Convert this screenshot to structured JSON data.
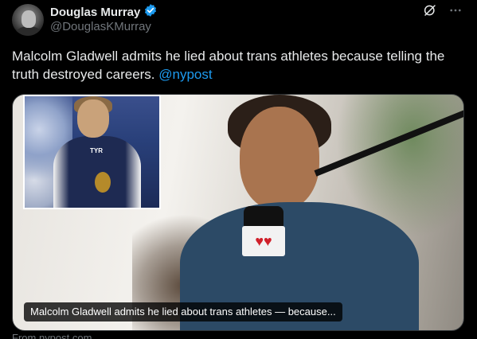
{
  "author": {
    "display_name": "Douglas Murray",
    "handle": "@DouglasKMurray",
    "verified_badge_color": "#1d9bf0"
  },
  "icons": {
    "verified": "verified-badge-icon",
    "grok": "grok-icon",
    "more": "more-icon"
  },
  "tweet": {
    "text": "Malcolm Gladwell admits he lied about trans athletes because telling the truth destroyed careers. ",
    "mention": "@nypost"
  },
  "media": {
    "caption": "Malcolm Gladwell admits he lied about trans athletes — because...",
    "inset_logo": "TYR",
    "mic_logo": "♥♥"
  },
  "card_source": "From nypost.com",
  "colors": {
    "background": "#000000",
    "text": "#e7e9ea",
    "muted": "#71767b",
    "link": "#1d9bf0"
  }
}
